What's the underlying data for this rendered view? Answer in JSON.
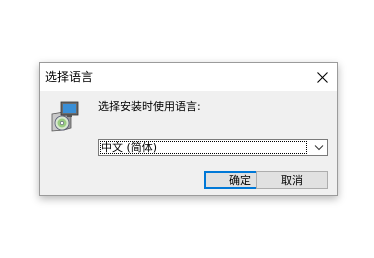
{
  "window": {
    "title": "选择语言"
  },
  "dialog": {
    "prompt": "选择安装时使用语言:",
    "language_select": {
      "selected": "中文 (简体)"
    },
    "buttons": {
      "ok_label": "确定",
      "cancel_label": "取消"
    }
  },
  "icons": {
    "close": "close-icon",
    "setup": "installer-setup-icon",
    "dropdown": "chevron-down-icon"
  },
  "colors": {
    "focus_border": "#0078d7",
    "dialog_bg": "#f0f0f0"
  }
}
